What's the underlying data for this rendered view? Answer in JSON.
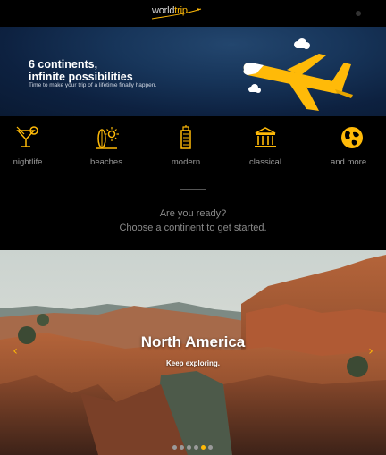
{
  "header": {
    "logo_part1": "world",
    "logo_part2": "trip"
  },
  "hero": {
    "title_line1": "6 continents,",
    "title_line2": "infinite possibilities",
    "subtitle": "Time to make your trip of a lifetime finally happen."
  },
  "categories": [
    {
      "label": "nightlife",
      "icon": "cocktail-icon"
    },
    {
      "label": "beaches",
      "icon": "surfboard-sun-icon"
    },
    {
      "label": "modern",
      "icon": "skyscraper-icon"
    },
    {
      "label": "classical",
      "icon": "museum-icon"
    },
    {
      "label": "and more...",
      "icon": "globe-icon"
    }
  ],
  "cta": {
    "line1": "Are you ready?",
    "line2": "Choose a continent to get started."
  },
  "slider": {
    "title": "North America",
    "subtitle": "Keep exploring.",
    "prev_icon": "chevron-left-icon",
    "next_icon": "chevron-right-icon",
    "total_slides": 6,
    "active_slide": 5
  },
  "colors": {
    "accent": "#ffba08",
    "background": "#000000",
    "hero": "#17355a",
    "muted_text": "#8a8a8a"
  }
}
